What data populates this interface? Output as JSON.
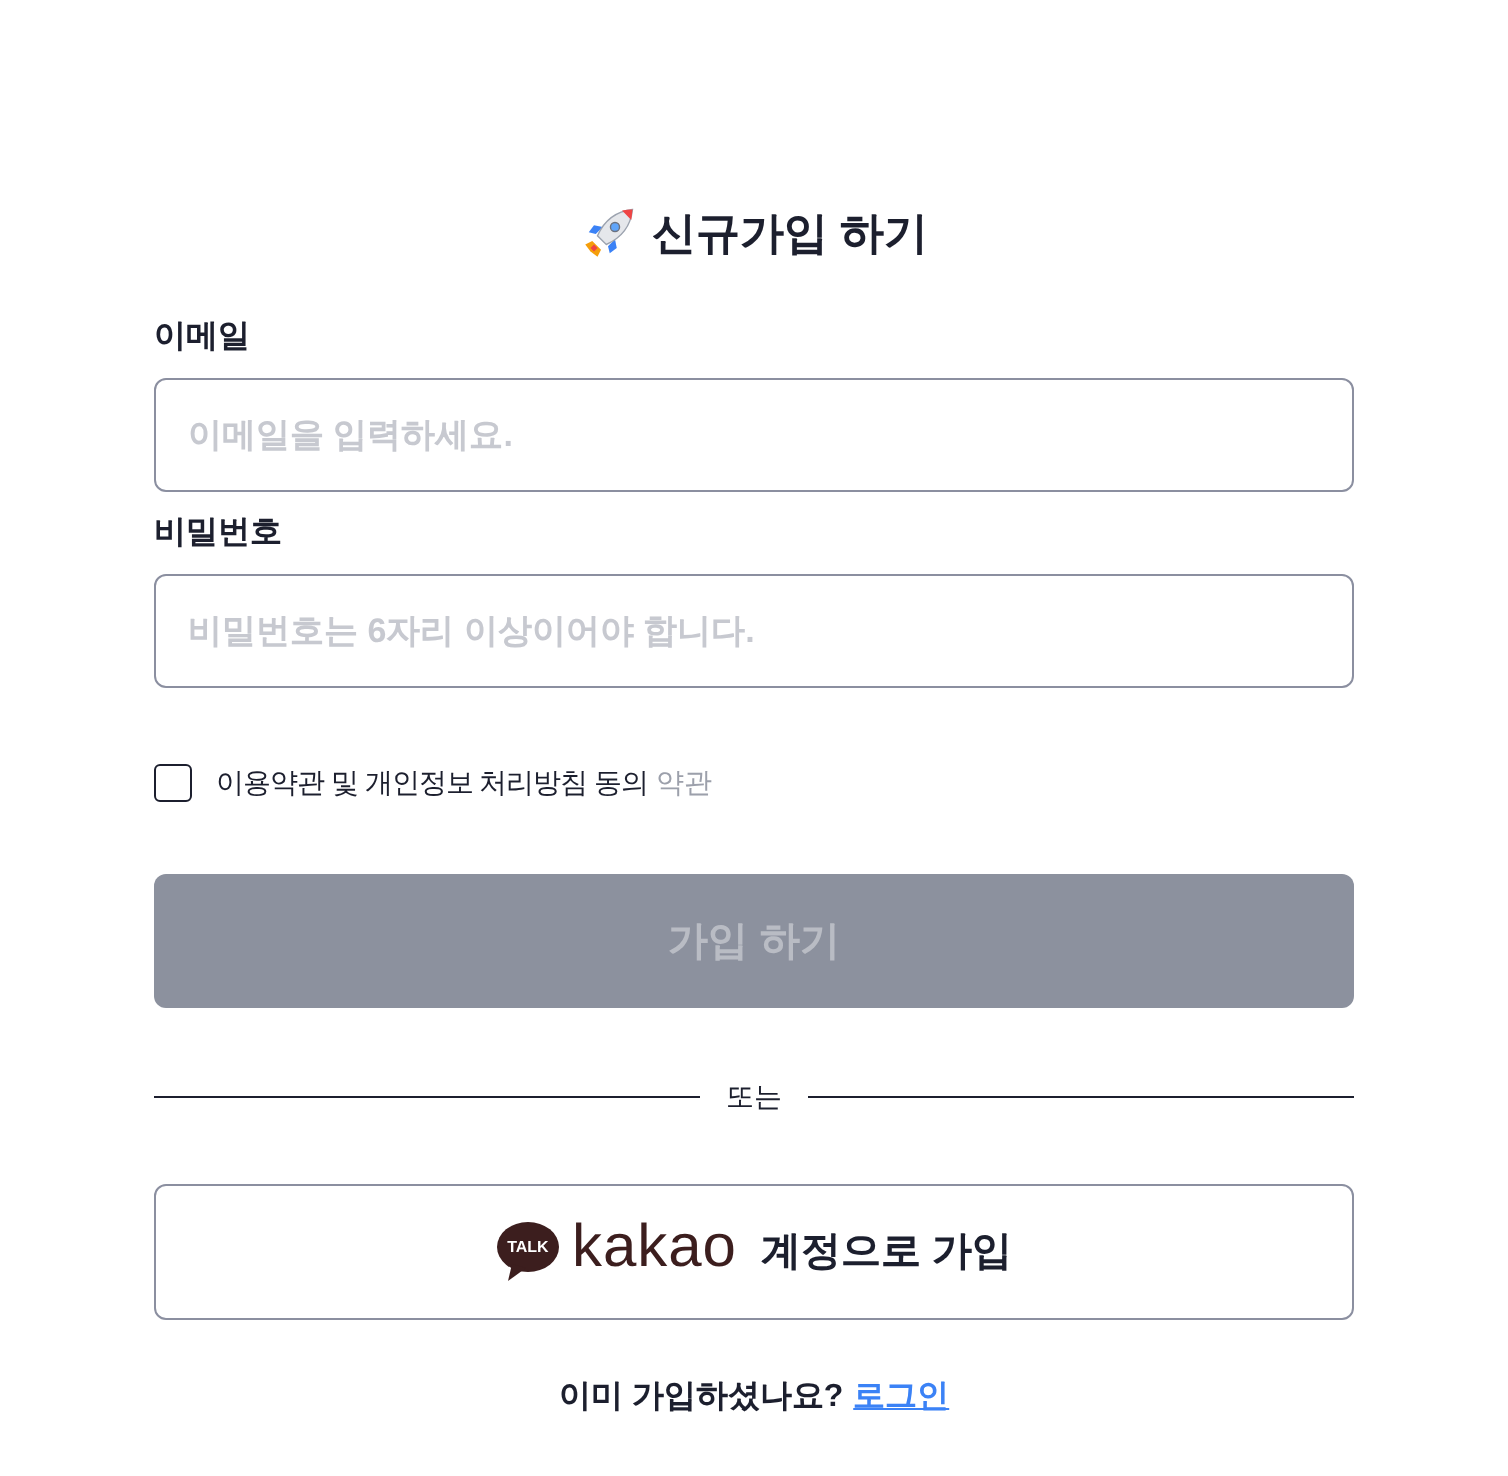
{
  "title": "신규가입 하기",
  "fields": [
    {
      "label": "이메일",
      "placeholder": "이메일을 입력하세요."
    },
    {
      "label": "비밀번호",
      "placeholder": "비밀번호는 6자리 이상이어야 합니다."
    }
  ],
  "terms": {
    "checked": false,
    "text": "이용약관 및 개인정보 처리방침 동의",
    "link": "약관"
  },
  "submit_button": {
    "label": "가입 하기",
    "disabled": true
  },
  "divider": {
    "label": "또는"
  },
  "kakao_button": {
    "logo_badge": "TALK",
    "logo_word": "kakao",
    "label": "계정으로 가입"
  },
  "footer": {
    "text": "이미 가입하셨나요?",
    "link": "로그인"
  }
}
